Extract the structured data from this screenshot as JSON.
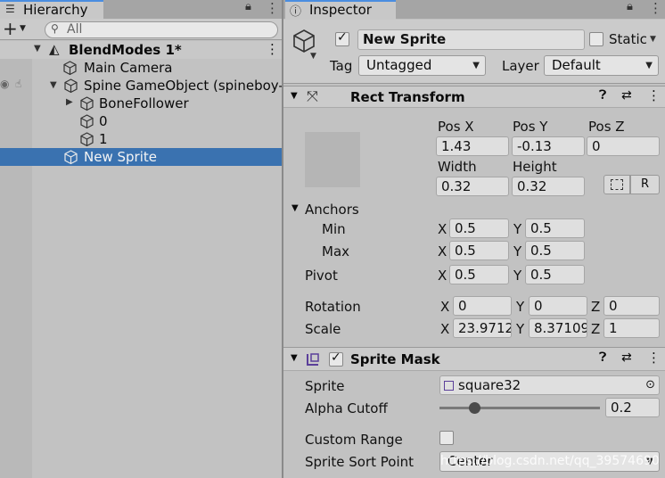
{
  "hierarchy": {
    "tab_label": "Hierarchy",
    "search_placeholder": "All",
    "scene_name": "BlendModes 1*",
    "items": [
      {
        "label": "Main Camera"
      },
      {
        "label": "Spine GameObject (spineboy-p"
      },
      {
        "label": "BoneFollower"
      },
      {
        "label": "0"
      },
      {
        "label": "1"
      },
      {
        "label": "New Sprite"
      }
    ]
  },
  "inspector": {
    "tab_label": "Inspector",
    "object_name": "New Sprite",
    "static_label": "Static",
    "tag_label": "Tag",
    "tag_value": "Untagged",
    "layer_label": "Layer",
    "layer_value": "Default",
    "rect_transform": {
      "title": "Rect Transform",
      "pos_x_label": "Pos X",
      "pos_y_label": "Pos Y",
      "pos_z_label": "Pos Z",
      "pos_x": "1.43",
      "pos_y": "-0.13",
      "pos_z": "0",
      "width_label": "Width",
      "height_label": "Height",
      "width": "0.32",
      "height": "0.32",
      "r_button": "R",
      "anchors_label": "Anchors",
      "min_label": "Min",
      "max_label": "Max",
      "min_x": "0.5",
      "min_y": "0.5",
      "max_x": "0.5",
      "max_y": "0.5",
      "pivot_label": "Pivot",
      "pivot_x": "0.5",
      "pivot_y": "0.5",
      "rotation_label": "Rotation",
      "rot_x": "0",
      "rot_y": "0",
      "rot_z": "0",
      "scale_label": "Scale",
      "scale_x": "23.9712",
      "scale_y": "8.37109",
      "scale_z": "1",
      "x": "X",
      "y": "Y",
      "z": "Z"
    },
    "sprite_mask": {
      "title": "Sprite Mask",
      "sprite_label": "Sprite",
      "sprite_value": "square32",
      "alpha_cutoff_label": "Alpha Cutoff",
      "alpha_cutoff": "0.2",
      "custom_range_label": "Custom Range",
      "sort_point_label": "Sprite Sort Point",
      "sort_point_value": "Center"
    }
  },
  "watermark": "https://blog.csdn.net/qq_39574690"
}
